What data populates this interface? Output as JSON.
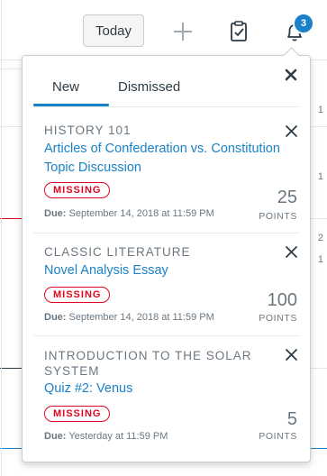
{
  "toolbar": {
    "today_label": "Today",
    "notification_count": "3",
    "accent_color": "#1a82c8"
  },
  "popover": {
    "tabs": [
      {
        "label": "New",
        "active": true
      },
      {
        "label": "Dismissed",
        "active": false
      }
    ],
    "items": [
      {
        "course": "HISTORY 101",
        "title": "Articles of Confederation vs. Constitution Topic Discussion",
        "status": "MISSING",
        "due_label": "Due:",
        "due_value": "September 14, 2018 at 11:59 PM",
        "points": "25",
        "points_label": "POINTS"
      },
      {
        "course": "CLASSIC LITERATURE",
        "title": "Novel Analysis Essay",
        "status": "MISSING",
        "due_label": "Due:",
        "due_value": "September 14, 2018 at 11:59 PM",
        "points": "100",
        "points_label": "POINTS"
      },
      {
        "course": "INTRODUCTION TO THE SOLAR SYSTEM",
        "title": "Quiz #2: Venus",
        "status": "MISSING",
        "due_label": "Due:",
        "due_value": "Yesterday at 11:59 PM",
        "points": "5",
        "points_label": "POINTS"
      }
    ]
  },
  "background": {
    "day_numbers": [
      "1",
      "1",
      "2",
      "1"
    ]
  },
  "icons": {
    "add": "plus-icon",
    "todo": "clipboard-check-icon",
    "notifications": "bell-icon",
    "close": "close-icon"
  },
  "status_color": "#e0061f"
}
